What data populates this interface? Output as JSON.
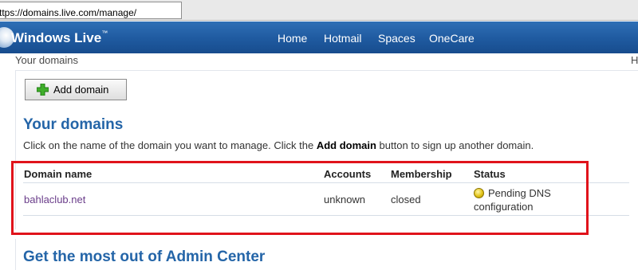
{
  "browser": {
    "url": "ttps://domains.live.com/manage/"
  },
  "header": {
    "brand": "Windows Live",
    "trademark": "™",
    "nav": [
      "Home",
      "Hotmail",
      "Spaces",
      "OneCare"
    ]
  },
  "breadcrumb": "Your domains",
  "right_edge_text": "H",
  "toolbar": {
    "add_domain_label": "Add domain"
  },
  "main": {
    "title": "Your domains",
    "intro_before": "Click on the name of the domain you want to manage. Click the ",
    "intro_bold": "Add domain",
    "intro_after": " button to sign up another domain.",
    "table": {
      "columns": [
        "Domain name",
        "Accounts",
        "Membership",
        "Status"
      ],
      "rows": [
        {
          "domain": "bahlaclub.net",
          "accounts": "unknown",
          "membership": "closed",
          "status_line1": "Pending DNS",
          "status_line2": "configuration"
        }
      ]
    },
    "section2_title": "Get the most out of Admin Center"
  },
  "colors": {
    "header_blue": "#1f5aa0",
    "heading_blue": "#2465a8",
    "link_purple": "#6a3d8a",
    "highlight_red": "#e0131b",
    "status_yellow": "#e2c419",
    "plus_green": "#3fae2a"
  },
  "icons": {
    "logo": "windows-live-logo",
    "add": "green-plus-icon",
    "status": "yellow-status-dot-icon"
  }
}
